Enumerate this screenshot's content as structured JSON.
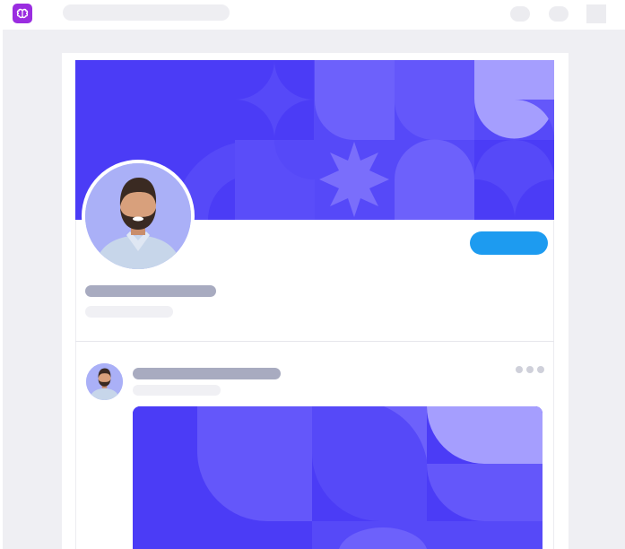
{
  "app": {
    "logo_icon": "brain-icon",
    "brand_color": "#9a2de0"
  },
  "header": {
    "search_icon_placeholder": "search-bar",
    "icons": [
      "notification-icon",
      "message-icon",
      "profile-icon"
    ]
  },
  "profile": {
    "cover_color": "#4b3cf6",
    "avatar_icon": "user-avatar",
    "follow_button_color": "#1d9bf0"
  },
  "post": {
    "avatar_icon": "user-avatar",
    "more_icon": "more-options-icon",
    "image_color": "#4b3cf6"
  }
}
